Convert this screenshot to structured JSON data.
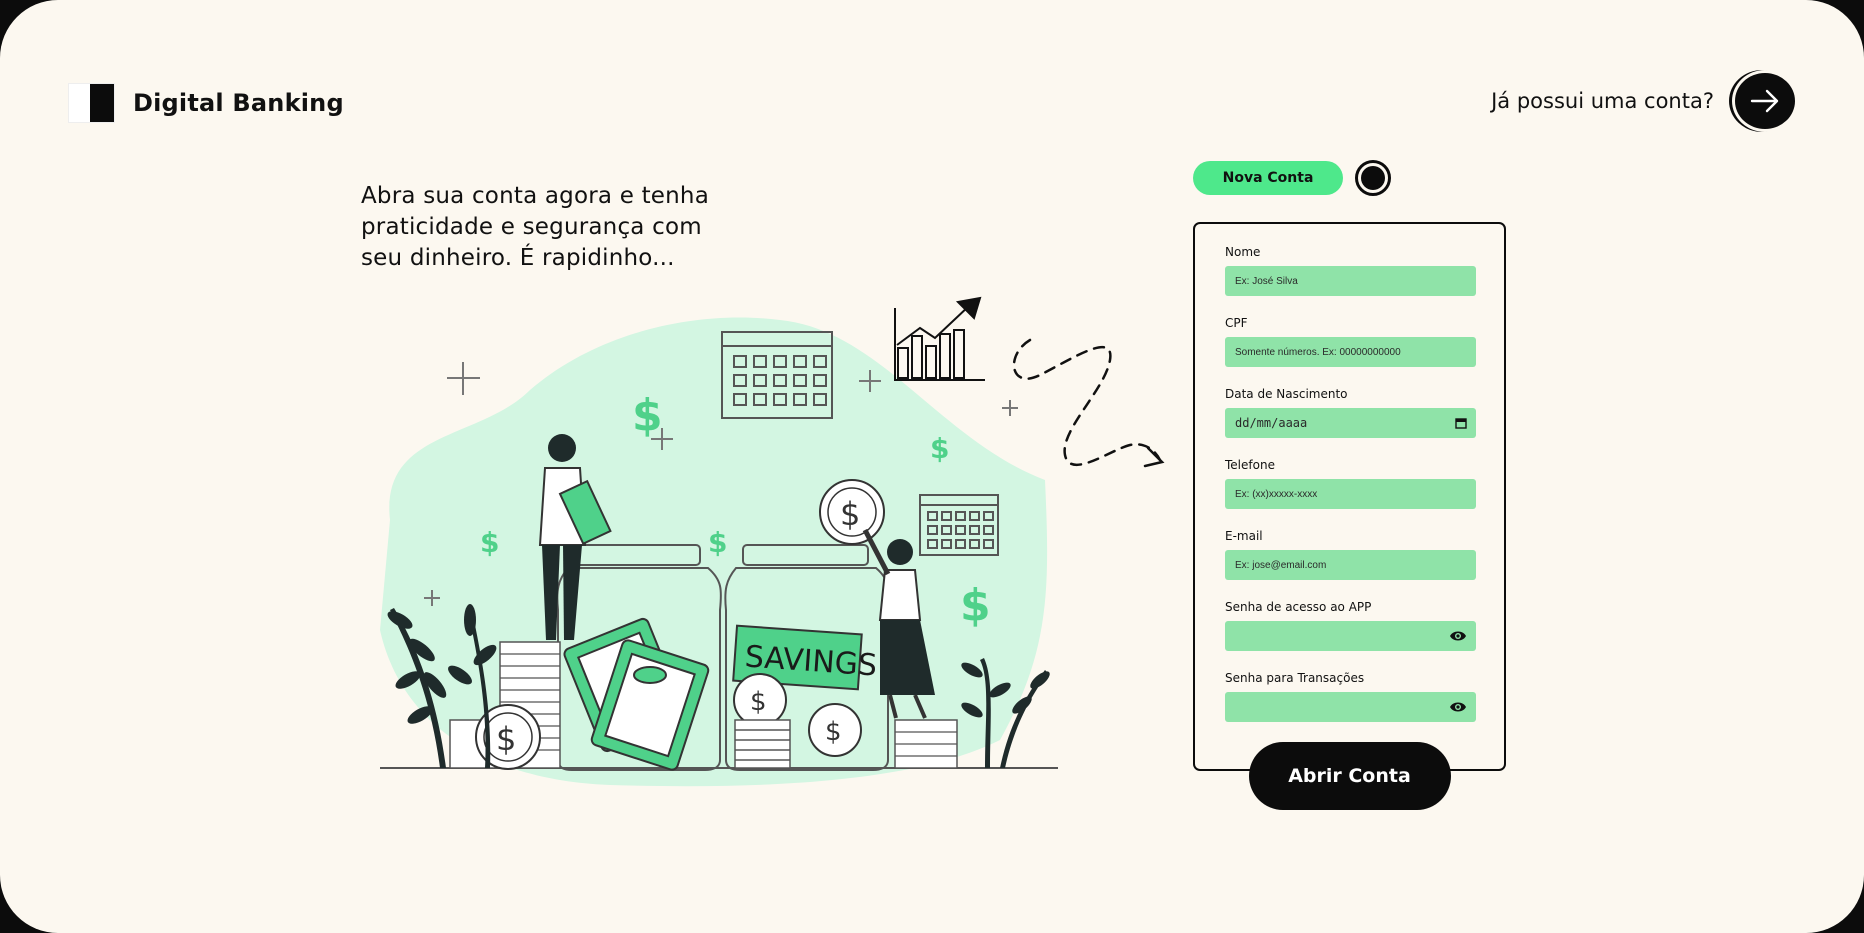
{
  "header": {
    "brand": "Digital Banking",
    "login_prompt": "Já possui uma conta?",
    "login_button_icon": "arrow-right-icon"
  },
  "hero": {
    "headline": "Abra sua conta agora e tenha praticidade e segurança com seu dinheiro. É rapidinho...",
    "illustration_jar_label": "SAVINGS"
  },
  "tabs": {
    "new_account": "Nova Conta",
    "toggle_icon": "circle-toggle-icon"
  },
  "form": {
    "name_label": "Nome",
    "name_placeholder": "Ex: José Silva",
    "cpf_label": "CPF",
    "cpf_placeholder": "Somente números. Ex: 00000000000",
    "birth_label": "Data de Nascimento",
    "birth_placeholder": "dd/mm/aaaa",
    "phone_label": "Telefone",
    "phone_placeholder": "Ex: (xx)xxxxx-xxxx",
    "email_label": "E-mail",
    "email_placeholder": "Ex: jose@email.com",
    "app_password_label": "Senha de acesso ao APP",
    "tx_password_label": "Senha para Transações",
    "submit_label": "Abrir Conta"
  },
  "colors": {
    "background": "#fcf8f0",
    "accent_green": "#4ee88b",
    "input_green": "#8fe3a8",
    "dark": "#0c0c0c"
  }
}
